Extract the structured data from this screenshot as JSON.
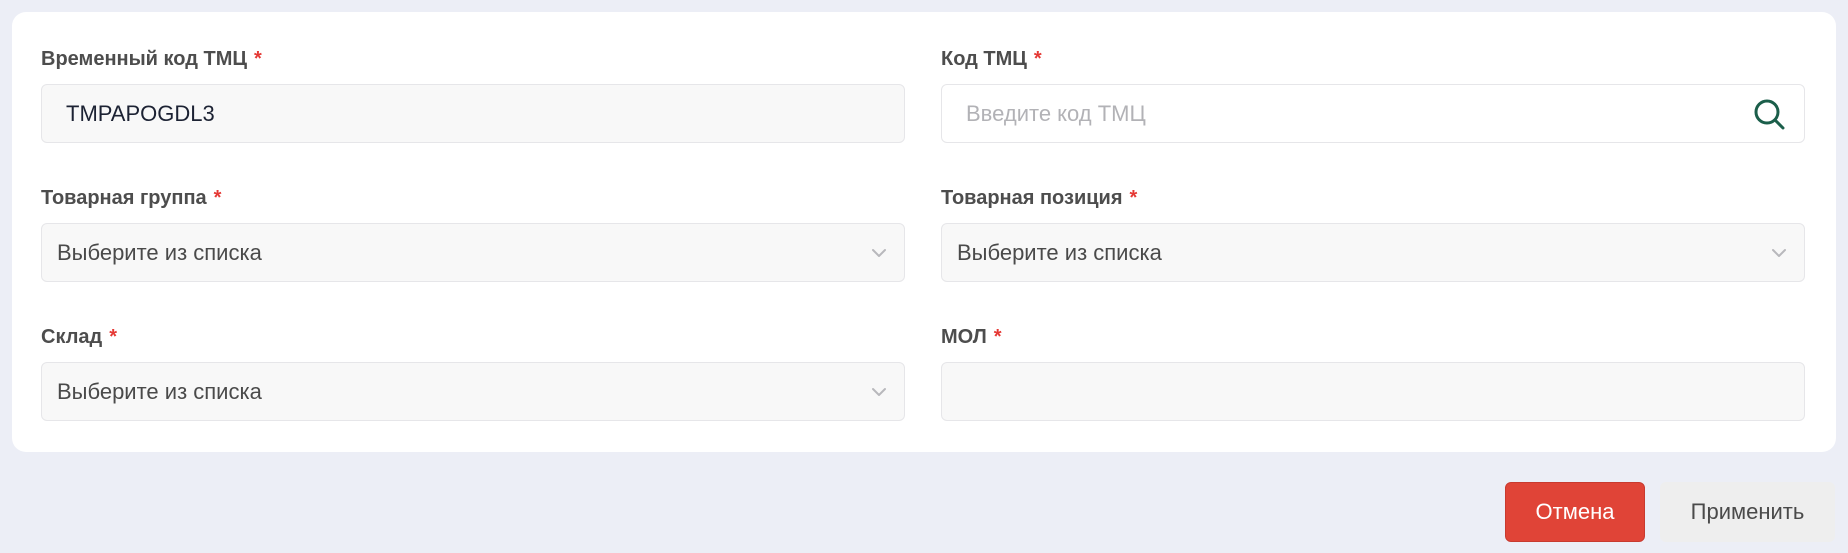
{
  "form": {
    "temp_code": {
      "label": "Временный код ТМЦ",
      "required_mark": "*",
      "value": "TMPAPOGDL3"
    },
    "tmc_code": {
      "label": "Код ТМЦ",
      "required_mark": "*",
      "placeholder": "Введите код ТМЦ",
      "icon": "search-icon"
    },
    "product_group": {
      "label": "Товарная группа",
      "required_mark": "*",
      "selected": "Выберите из списка",
      "icon": "chevron-down-icon"
    },
    "product_position": {
      "label": "Товарная позиция",
      "required_mark": "*",
      "selected": "Выберите из списка",
      "icon": "chevron-down-icon"
    },
    "warehouse": {
      "label": "Склад",
      "required_mark": "*",
      "selected": "Выберите из списка",
      "icon": "chevron-down-icon"
    },
    "mol": {
      "label": "МОЛ",
      "required_mark": "*",
      "value": ""
    }
  },
  "actions": {
    "cancel_label": "Отмена",
    "apply_label": "Применить"
  },
  "colors": {
    "background": "#eceef6",
    "card": "#ffffff",
    "required": "#e53935",
    "cancel_button": "#e04437",
    "apply_button": "#eeeeee",
    "search_icon": "#1b5e4a"
  }
}
